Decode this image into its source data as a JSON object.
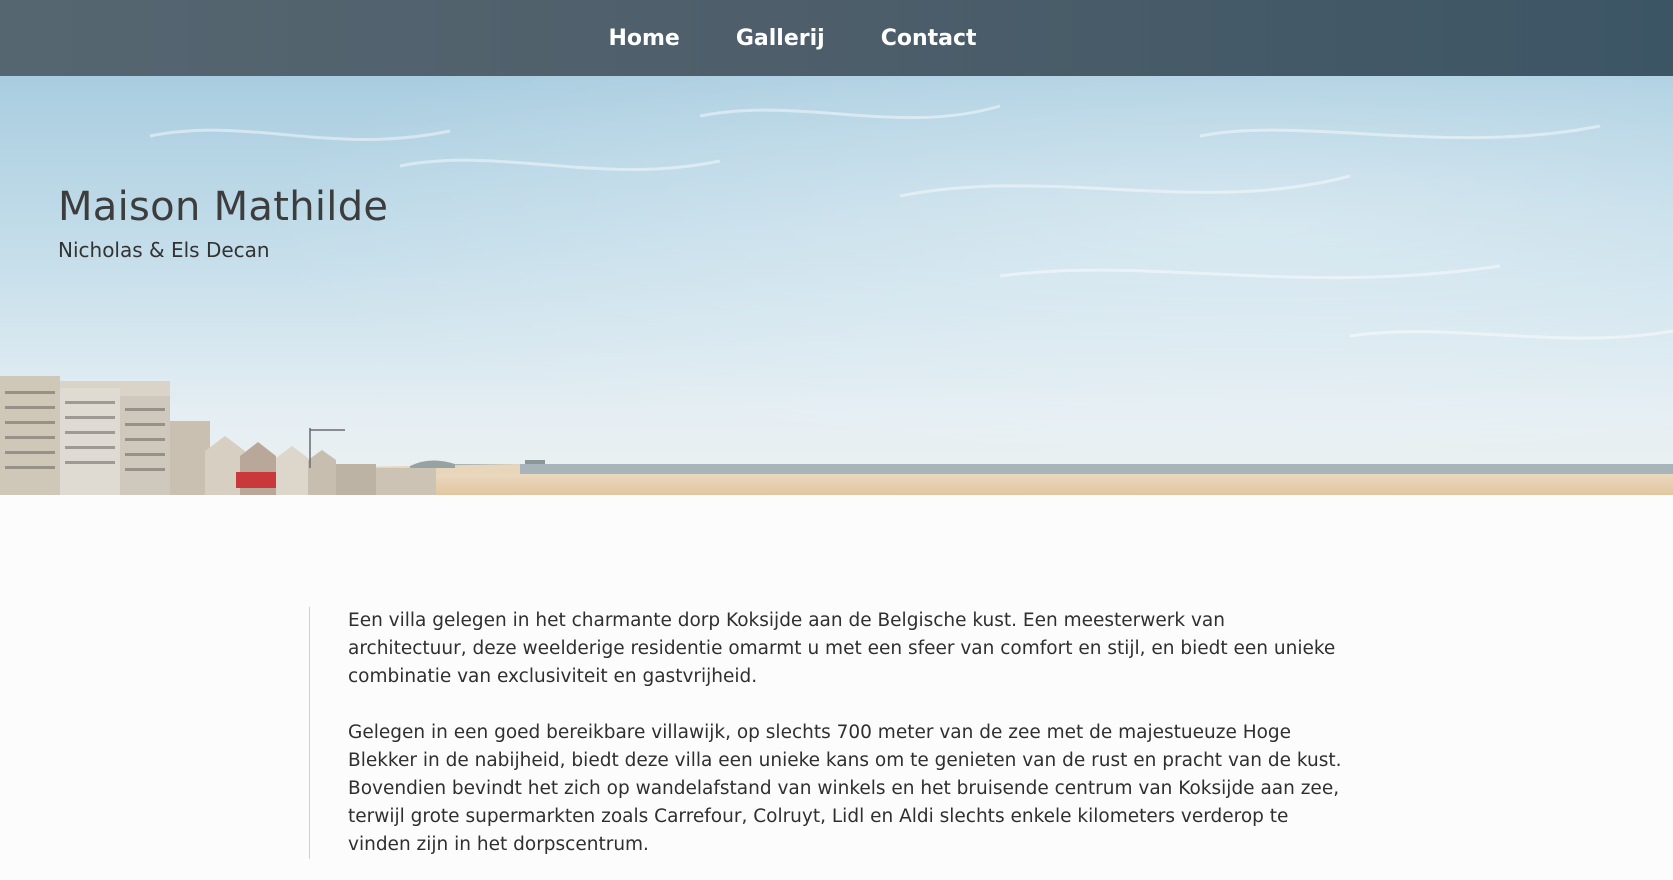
{
  "nav": {
    "items": [
      {
        "label": "Home"
      },
      {
        "label": "Gallerij"
      },
      {
        "label": "Contact"
      }
    ]
  },
  "hero": {
    "title": "Maison Mathilde",
    "subtitle": "Nicholas & Els Decan"
  },
  "content": {
    "paragraphs": [
      "Een villa gelegen in het charmante dorp Koksijde aan de Belgische kust. Een meesterwerk van architectuur, deze weelderige residentie omarmt u met een sfeer van comfort en stijl, en biedt een unieke combinatie van exclusiviteit en gastvrijheid.",
      "Gelegen in een goed bereikbare villawijk, op slechts 700 meter van de zee met de majestueuze Hoge Blekker in de nabijheid, biedt deze villa een unieke kans om te genieten van de rust en pracht van de kust. Bovendien bevindt het zich op wandelafstand van winkels en het bruisende centrum van Koksijde aan zee, terwijl grote supermarkten zoals Carrefour, Colruyt, Lidl en Aldi slechts enkele kilometers verderop te vinden zijn in het dorpscentrum."
    ]
  },
  "colors": {
    "nav_bg": "#4d5e6a",
    "nav_text": "#ffffff",
    "page_bg": "#fcfcfc",
    "text": "#2f2f2f"
  }
}
